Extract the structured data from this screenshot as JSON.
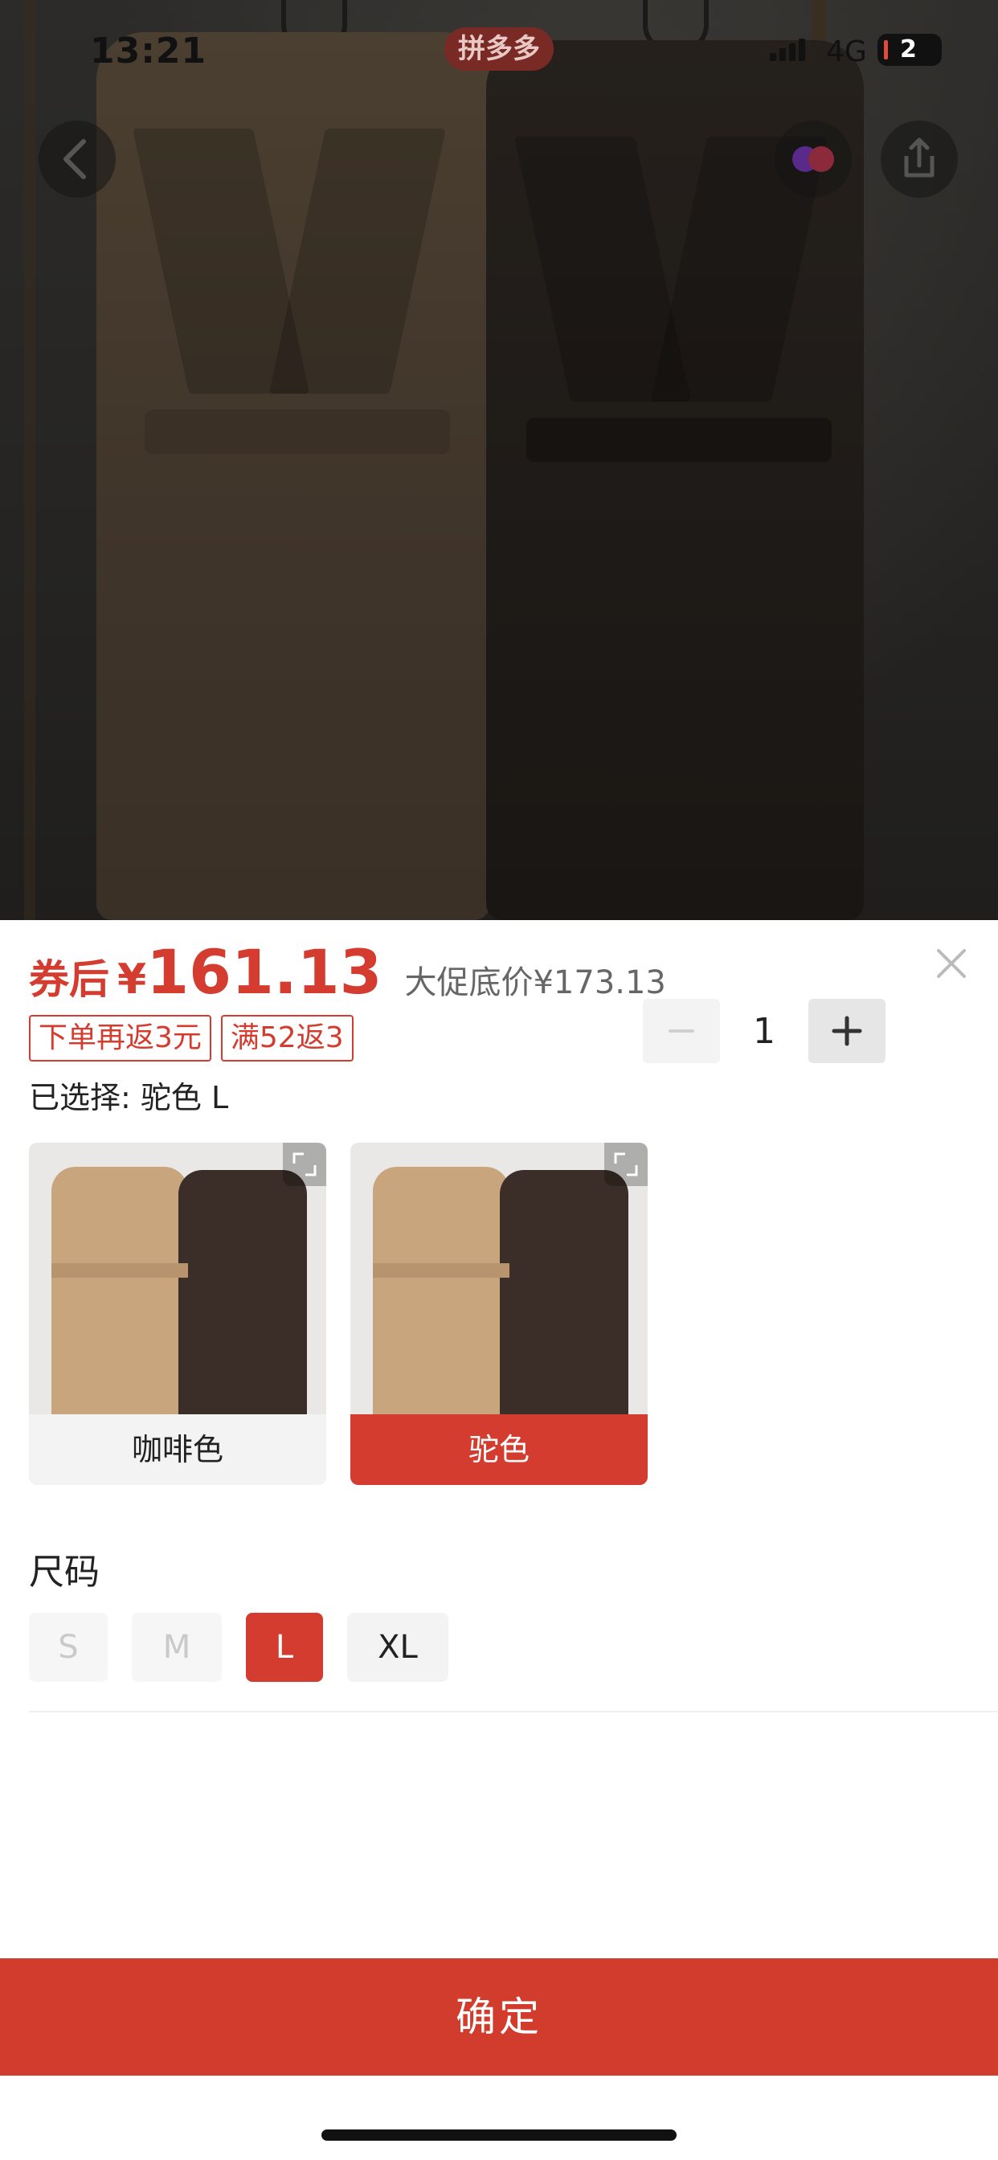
{
  "status_bar": {
    "time": "13:21",
    "app_badge": "拼多多",
    "network": "4G",
    "battery": "2"
  },
  "header": {
    "icons": [
      "back-icon",
      "favorite-icon",
      "share-icon"
    ]
  },
  "product": {
    "price_prefix": "券后",
    "price_symbol": "¥",
    "price": "161.13",
    "original_price": "大促底价¥173.13",
    "tags": [
      "下单再返3元",
      "满52返3"
    ],
    "selected": "已选择: 驼色 L"
  },
  "quantity": {
    "value": "1",
    "minus_label": "−",
    "plus_label": "+"
  },
  "colors": [
    {
      "label": "咖啡色",
      "active": false
    },
    {
      "label": "驼色",
      "active": true
    }
  ],
  "size": {
    "title": "尺码",
    "options": [
      {
        "label": "S",
        "state": "disabled"
      },
      {
        "label": "M",
        "state": "disabled"
      },
      {
        "label": "L",
        "state": "active"
      },
      {
        "label": "XL",
        "state": "normal"
      }
    ]
  },
  "confirm_label": "确定",
  "theme": {
    "accent": "#d33c2e"
  }
}
